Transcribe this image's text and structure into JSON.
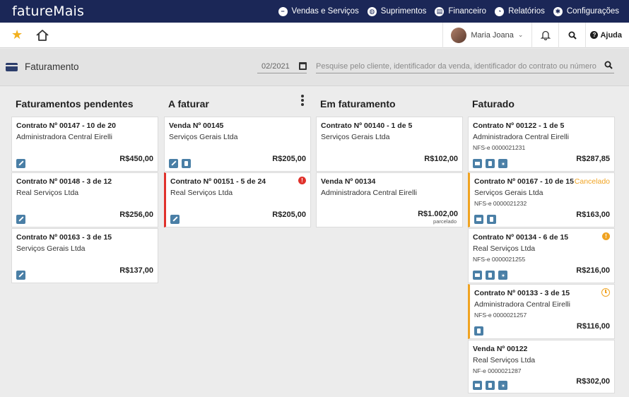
{
  "app": {
    "logo": "fatureMais"
  },
  "nav": [
    {
      "label": "Vendas e Serviços",
      "icon": "minus-circle-icon"
    },
    {
      "label": "Suprimentos",
      "icon": "globe-icon"
    },
    {
      "label": "Financeiro",
      "icon": "wallet-icon"
    },
    {
      "label": "Relatórios",
      "icon": "pie-chart-icon"
    },
    {
      "label": "Configurações",
      "icon": "gear-icon"
    }
  ],
  "user": {
    "name": "Maria Joana"
  },
  "help": {
    "label": "Ajuda"
  },
  "page": {
    "title": "Faturamento",
    "period": "02/2021",
    "search_placeholder": "Pesquise pelo cliente, identificador da venda, identificador do contrato ou número da NF"
  },
  "columns": [
    {
      "title": "Faturamentos pendentes",
      "cards": [
        {
          "title": "Contrato Nº 00147 - 10 de 20",
          "client": "Administradora Central Eirelli",
          "value": "R$450,00"
        },
        {
          "title": "Contrato Nº 00148 - 3 de 12",
          "client": "Real Serviços Ltda",
          "value": "R$256,00"
        },
        {
          "title": "Contrato Nº 00163 - 3 de 15",
          "client": "Serviços Gerais Ltda",
          "value": "R$137,00"
        }
      ]
    },
    {
      "title": "A faturar",
      "cards": [
        {
          "title": "Venda Nº 00145",
          "client": "Serviços Gerais Ltda",
          "value": "R$205,00"
        },
        {
          "title": "Contrato Nº 00151 - 5 de 24",
          "client": "Real Serviços Ltda",
          "value": "R$205,00",
          "badge": "!"
        }
      ]
    },
    {
      "title": "Em faturamento",
      "cards": [
        {
          "title": "Contrato Nº 00140 - 1 de 5",
          "client": "Serviços Gerais Ltda",
          "value": "R$102,00"
        },
        {
          "title": "Venda Nº 00134",
          "client": "Administradora Central Eirelli",
          "value": "R$1.002,00",
          "sub": "parcelado"
        }
      ]
    },
    {
      "title": "Faturado",
      "cards": [
        {
          "title": "Contrato Nº 00122 - 1 de 5",
          "client": "Administradora Central Eirelli",
          "nf": "NFS-e 0000021231",
          "value": "R$287,85"
        },
        {
          "title": "Contrato Nº 00167 - 10 de 15",
          "client": "Serviços Gerais Ltda",
          "nf": "NFS-e 0000021232",
          "value": "R$163,00",
          "status": "Cancelado"
        },
        {
          "title": "Contrato Nº 00134 - 6 de 15",
          "client": "Real Serviços Ltda",
          "nf": "NFS-e 0000021255",
          "value": "R$216,00",
          "badge": "!"
        },
        {
          "title": "Contrato Nº 00133 - 3 de 15",
          "client": "Administradora Central Eirelli",
          "nf": "NFS-e 0000021257",
          "value": "R$116,00"
        },
        {
          "title": "Venda Nº 00122",
          "client": "Real Serviços Ltda",
          "nf": "NF-e 0000021287",
          "value": "R$302,00"
        }
      ]
    }
  ],
  "colors": {
    "nav_bg": "#1b2757",
    "accent_blue": "#4a7fa6",
    "alert_red": "#e0312b",
    "warning_orange": "#f0a321",
    "star": "#f2b01e"
  }
}
